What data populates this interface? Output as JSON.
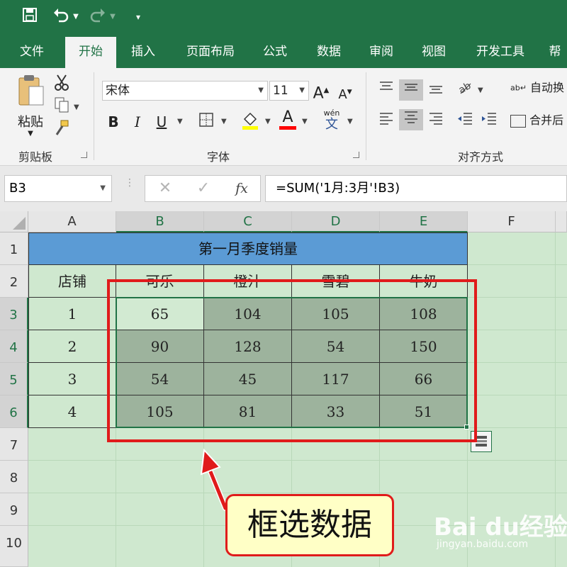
{
  "quick_access": {
    "save_icon": "save-icon",
    "undo_icon": "undo-icon",
    "redo_icon": "redo-icon",
    "customize_icon": "customize-icon"
  },
  "tabs": [
    "文件",
    "开始",
    "插入",
    "页面布局",
    "公式",
    "数据",
    "审阅",
    "视图",
    "开发工具",
    "帮"
  ],
  "ribbon": {
    "clipboard": {
      "paste_label": "粘贴",
      "group_label": "剪贴板"
    },
    "font": {
      "font_name": "宋体",
      "font_size": "11",
      "grow_label": "A",
      "shrink_label": "A",
      "bold_label": "B",
      "italic_label": "I",
      "underline_label": "U",
      "font_color_label": "A",
      "phonetic_top": "wén",
      "phonetic_bottom": "文",
      "group_label": "字体"
    },
    "alignment": {
      "wrap_label": "自动换",
      "merge_label": "合并后",
      "group_label": "对齐方式"
    }
  },
  "formula_bar": {
    "name_box": "B3",
    "fx_label": "fx",
    "formula": "=SUM('1月:3月'!B3)"
  },
  "colors": {
    "excel_green": "#217346",
    "title_fill": "#5b9bd5",
    "data_fill": "#9db39d",
    "sheet_bg": "#cfe8cf",
    "annotation_red": "#e01b1b",
    "callout_fill": "#ffffc6"
  },
  "grid": {
    "columns": [
      "A",
      "B",
      "C",
      "D",
      "E",
      "F"
    ],
    "rows": [
      "1",
      "2",
      "3",
      "4",
      "5",
      "6",
      "7",
      "8",
      "9",
      "10"
    ],
    "selected_columns": [
      "B",
      "C",
      "D",
      "E"
    ],
    "selected_rows": [
      "3",
      "4",
      "5",
      "6"
    ]
  },
  "table": {
    "title": "第一月季度销量",
    "headers": [
      "店铺",
      "可乐",
      "橙汁",
      "雪碧",
      "牛奶"
    ],
    "rows": [
      [
        "1",
        "65",
        "104",
        "105",
        "108"
      ],
      [
        "2",
        "90",
        "128",
        "54",
        "150"
      ],
      [
        "3",
        "54",
        "45",
        "117",
        "66"
      ],
      [
        "4",
        "105",
        "81",
        "33",
        "51"
      ]
    ]
  },
  "annotation": {
    "callout_text": "框选数据"
  },
  "watermark": {
    "logo": "Bai du经验",
    "url": "jingyan.baidu.com"
  }
}
